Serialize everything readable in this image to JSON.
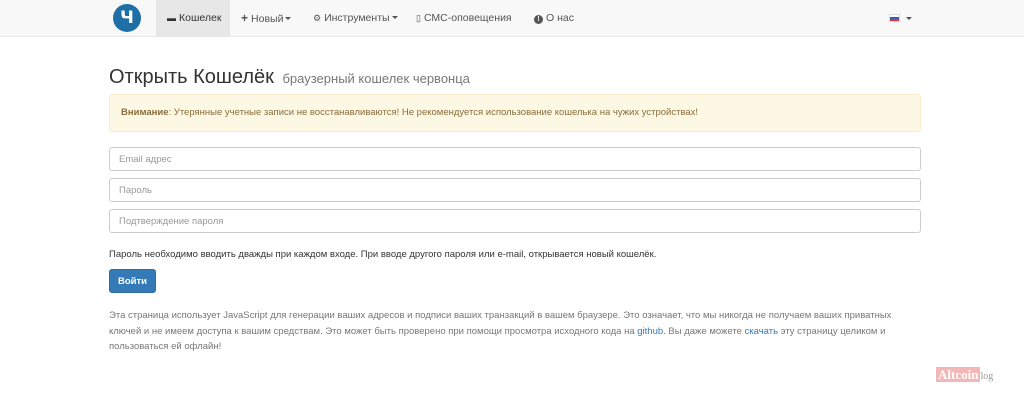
{
  "navbar": {
    "logo_glyph": "Ч",
    "items": [
      {
        "label": "Кошелек",
        "icon": "wallet-icon",
        "active": true
      },
      {
        "label": "Новый",
        "icon": "plus-icon",
        "dropdown": true
      },
      {
        "label": "Инструменты",
        "icon": "gear-icon",
        "dropdown": true
      },
      {
        "label": "СМС-оповещения",
        "icon": "phone-icon"
      },
      {
        "label": "О нас",
        "icon": "info-icon"
      }
    ],
    "language_flag": "ru-flag-icon"
  },
  "page": {
    "title": "Открыть Кошелёк",
    "subtitle": "браузерный кошелек червонца"
  },
  "alert": {
    "strong": "Внимание",
    "text": ": Утерянные учетные записи не восстанавливаются! Не рекомендуется использование кошелька на чужих устройствах!"
  },
  "form": {
    "email_placeholder": "Email адрес",
    "password_placeholder": "Пароль",
    "confirm_placeholder": "Подтверждение пароля",
    "hint": "Пароль необходимо вводить дважды при каждом входе. При вводе другого пароля или e-mail, открывается новый кошелёк.",
    "submit_label": "Войти"
  },
  "info": {
    "part1": "Эта страница использует JavaScript для генерации ваших адресов и подписи ваших транзакций в вашем браузере. Это означает, что мы никогда не получаем ваших приватных ключей и не имеем доступа к вашим средствам. Это может быть проверено при помощи просмотра исходного кода на ",
    "link1": "github",
    "part2": ". Вы даже можете ",
    "link2": "скачать",
    "part3": " эту страницу целиком и пользоваться ей офлайн!"
  },
  "watermark": {
    "brand": "Altcoin",
    "suffix": "log"
  },
  "colors": {
    "primary": "#337ab7",
    "alert_bg": "#fcf8e3",
    "alert_text": "#8a6d3b",
    "logo_bg": "#1d6fa5"
  }
}
